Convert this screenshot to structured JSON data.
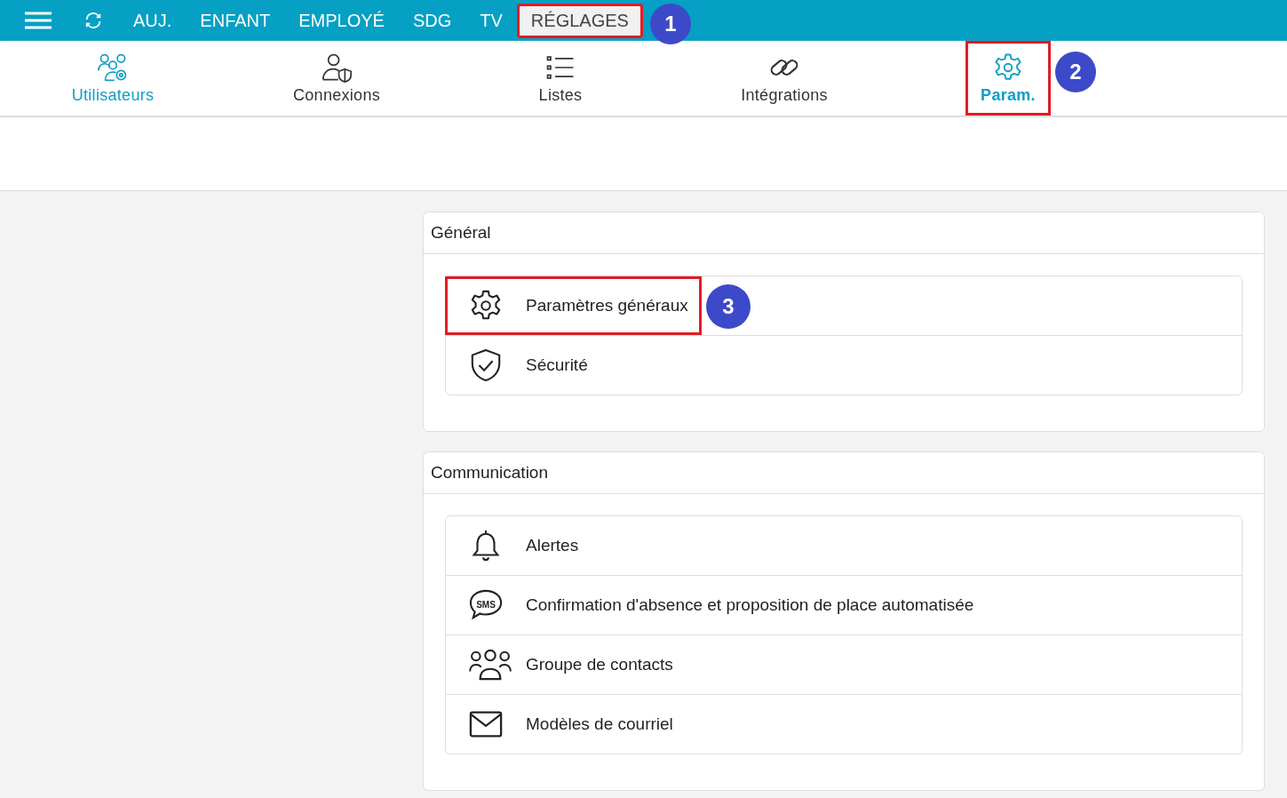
{
  "top_menu": [
    {
      "label": "AUJ.",
      "selected": false,
      "highlighted": false
    },
    {
      "label": "ENFANT",
      "selected": false,
      "highlighted": false
    },
    {
      "label": "EMPLOYÉ",
      "selected": false,
      "highlighted": false
    },
    {
      "label": "SDG",
      "selected": false,
      "highlighted": false
    },
    {
      "label": "TV",
      "selected": false,
      "highlighted": false
    },
    {
      "label": "RÉGLAGES",
      "selected": true,
      "highlighted": true,
      "callout": "1"
    }
  ],
  "sub_menu": [
    {
      "label": "Utilisateurs",
      "selected": true,
      "highlighted": false
    },
    {
      "label": "Connexions",
      "selected": false,
      "highlighted": false
    },
    {
      "label": "Listes",
      "selected": false,
      "highlighted": false
    },
    {
      "label": "Intégrations",
      "selected": false,
      "highlighted": false
    },
    {
      "label": "Param.",
      "selected": true,
      "highlighted": true,
      "callout": "2"
    }
  ],
  "sections": [
    {
      "title": "Général",
      "items": [
        {
          "label": "Paramètres généraux",
          "highlighted": true,
          "callout": "3"
        },
        {
          "label": "Sécurité",
          "highlighted": false
        }
      ]
    },
    {
      "title": "Communication",
      "items": [
        {
          "label": "Alertes",
          "highlighted": false
        },
        {
          "label": "Confirmation d'absence et proposition de place automatisée",
          "icon_text": "SMS",
          "highlighted": false
        },
        {
          "label": "Groupe de contacts",
          "highlighted": false
        },
        {
          "label": "Modèles de courriel",
          "highlighted": false
        }
      ]
    }
  ]
}
